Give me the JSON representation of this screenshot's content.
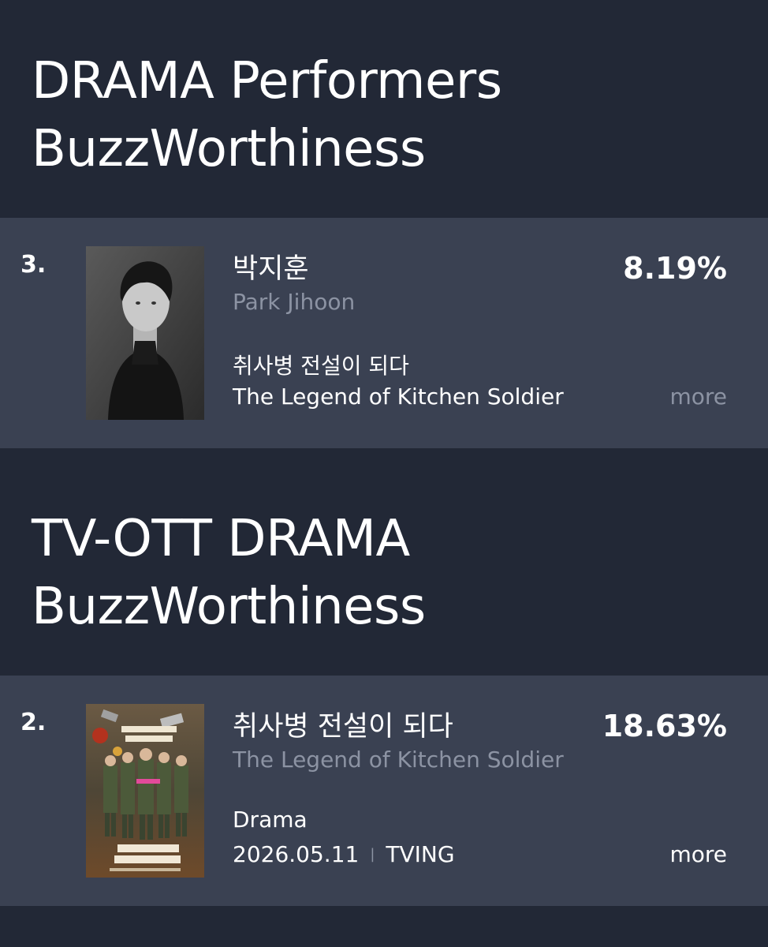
{
  "sections": [
    {
      "title_line1": "DRAMA Performers",
      "title_line2": "BuzzWorthiness",
      "entry": {
        "rank": "3.",
        "name_ko": "박지훈",
        "name_en": "Park Jihoon",
        "show_ko": "취사병 전설이 되다",
        "show_en": "The Legend of Kitchen Soldier",
        "percent": "8.19%",
        "more_label": "more",
        "image": "portrait-photo"
      }
    },
    {
      "title_line1": "TV-OTT DRAMA",
      "title_line2": "BuzzWorthiness",
      "entry": {
        "rank": "2.",
        "title_ko": "취사병 전설이 되다",
        "title_en": "The Legend of Kitchen Soldier",
        "genre": "Drama",
        "date": "2026.05.11",
        "separator": "|",
        "platform": "TVING",
        "percent": "18.63%",
        "more_label": "more",
        "image": "drama-poster"
      }
    }
  ],
  "colors": {
    "background": "#222836",
    "card": "#3a4152",
    "muted_text": "#8c93a3",
    "text": "#ffffff"
  }
}
